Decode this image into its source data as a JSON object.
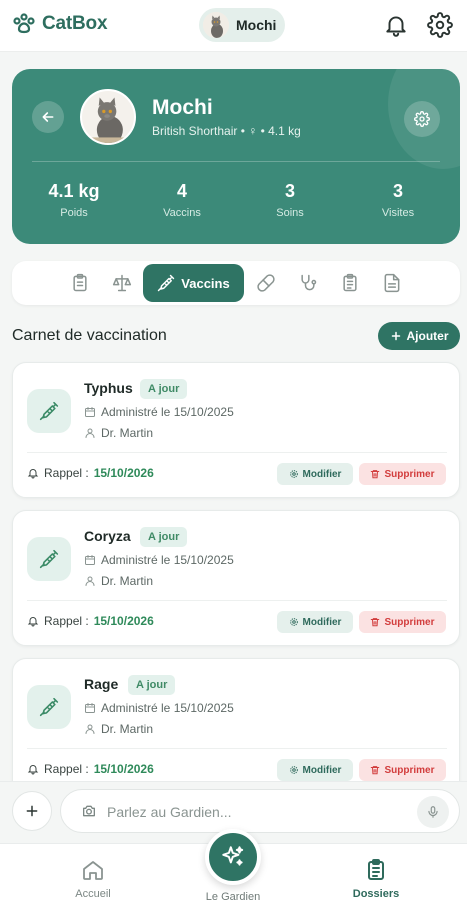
{
  "app": {
    "name": "CatBox"
  },
  "header": {
    "pet_chip": {
      "name": "Mochi"
    },
    "icons": [
      "bell-icon",
      "gear-icon"
    ]
  },
  "pet": {
    "name": "Mochi",
    "breed_line": "British Shorthair • ♀ • 4.1 kg",
    "stats": [
      {
        "value": "4.1 kg",
        "label": "Poids"
      },
      {
        "value": "4",
        "label": "Vaccins"
      },
      {
        "value": "3",
        "label": "Soins"
      },
      {
        "value": "3",
        "label": "Visites"
      }
    ]
  },
  "tabs": {
    "active_label": "Vaccins",
    "icons": [
      "clipboard-icon",
      "scale-icon",
      "syringe-icon",
      "pill-icon",
      "stethoscope-icon",
      "checklist-icon",
      "document-icon"
    ]
  },
  "section": {
    "title": "Carnet de vaccination",
    "add_label": "Ajouter"
  },
  "vaccines": [
    {
      "name": "Typhus",
      "status": "A jour",
      "administered": "Administré le 15/10/2025",
      "vet": "Dr. Martin",
      "reminder_label": "Rappel :",
      "reminder_date": "15/10/2026",
      "modify_label": "Modifier",
      "delete_label": "Supprimer"
    },
    {
      "name": "Coryza",
      "status": "A jour",
      "administered": "Administré le 15/10/2025",
      "vet": "Dr. Martin",
      "reminder_label": "Rappel :",
      "reminder_date": "15/10/2026",
      "modify_label": "Modifier",
      "delete_label": "Supprimer"
    },
    {
      "name": "Rage",
      "status": "A jour",
      "administered": "Administré le 15/10/2025",
      "vet": "Dr. Martin",
      "reminder_label": "Rappel :",
      "reminder_date": "15/10/2026",
      "modify_label": "Modifier",
      "delete_label": "Supprimer"
    }
  ],
  "chat": {
    "placeholder": "Parlez au Gardien..."
  },
  "nav": {
    "home": "Accueil",
    "guardian": "Le Gardien",
    "records": "Dossiers"
  },
  "colors": {
    "primary": "#2f7464",
    "hero": "#3c8a79",
    "success": "#2f8a5a",
    "danger": "#d23d3d"
  }
}
